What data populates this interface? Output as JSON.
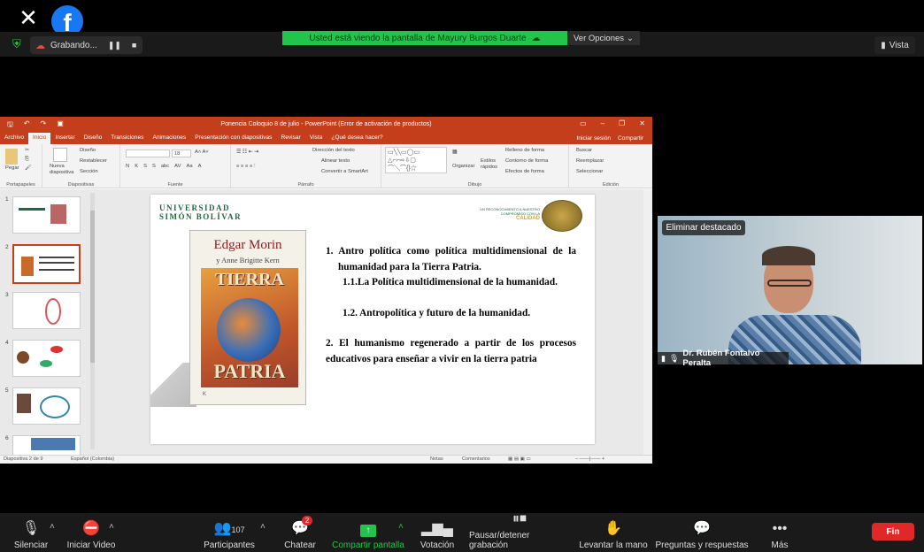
{
  "top": {
    "close_icon": "✕",
    "facebook_letter": "f",
    "recording_label": "Grabando...",
    "viewing_text": "Usted está viendo la pantalla de Mayury Burgos Duarte",
    "options_label": "Ver Opciones",
    "view_label": "Vista"
  },
  "ppt": {
    "title": "Ponencia Coloquio 8 de julio - PowerPoint (Error de activación de productos)",
    "tabs": [
      "Archivo",
      "Inicio",
      "Insertar",
      "Diseño",
      "Transiciones",
      "Animaciones",
      "Presentación con diapositivas",
      "Revisar",
      "Vista",
      "¿Qué desea hacer?"
    ],
    "active_tab": "Inicio",
    "signin": "Iniciar sesión",
    "share": "Compartir",
    "ribbon": {
      "paste": "Pegar",
      "new_slide": "Nueva diapositiva",
      "layout": "Diseño",
      "reset": "Restablecer",
      "section": "Sección",
      "font_size": "18",
      "groups": [
        "Portapapeles",
        "Diapositivas",
        "Fuente",
        "Párrafo",
        "Dibujo",
        "Edición"
      ],
      "text_direction": "Dirección del texto",
      "align_text": "Alinear texto",
      "smartart": "Convertir a SmartArt",
      "organize": "Organizar",
      "quick_styles": "Estilos rápidos",
      "shape_fill": "Relleno de forma",
      "shape_outline": "Contorno de forma",
      "shape_effects": "Efectos de forma",
      "find": "Buscar",
      "replace": "Reemplazar",
      "select": "Seleccionar",
      "font_buttons": [
        "N",
        "K",
        "S",
        "S",
        "abc",
        "AV",
        "Aa",
        "A"
      ]
    },
    "status": {
      "slide": "Diapositiva 2 de 9",
      "language": "Español (Colombia)",
      "notes": "Notas",
      "comments": "Comentarios"
    },
    "thumbnails": [
      "1",
      "2",
      "3",
      "4",
      "5",
      "6"
    ],
    "selected_thumb": "2"
  },
  "slide": {
    "university": "UNIVERSIDAD",
    "university2": "SIMÓN BOLÍVAR",
    "accred_small": "UN RECONOCIMIENTO A NUESTRO COMPROMISO CON LA",
    "accred_big": "CALIDAD",
    "book_author": "Edgar Morin",
    "book_coauthor": "y Anne Brigitte Kern",
    "book_title1": "TIERRA",
    "book_title2": "PATRIA",
    "item1": "1.  Antro política como política multidimensional de la humanidad para la Tierra Patria.",
    "item1_1": "1.1.La   Política   multidimensional   de   la humanidad.",
    "item1_2": "1.2. Antropolítica y futuro de la humanidad.",
    "item2": "2.   El humanismo regenerado a partir de los procesos educativos para enseñar a vivir en la tierra patria"
  },
  "video": {
    "remove_spotlight": "Eliminar destacado",
    "participant_name": "Dr. Rubén Fontalvo Peralta"
  },
  "bottom": {
    "mute": "Silenciar",
    "start_video": "Iniciar Video",
    "participants": "Participantes",
    "participants_count": "107",
    "chat": "Chatear",
    "chat_badge": "2",
    "share": "Compartir pantalla",
    "poll": "Votación",
    "pause_rec": "Pausar/detener grabación",
    "raise_hand": "Levantar la mano",
    "qa": "Preguntas y respuestas",
    "more": "Más",
    "end": "Fin"
  },
  "colors": {
    "ppt_accent": "#c43e1c",
    "zoom_green": "#23c44c",
    "end_red": "#e02828"
  }
}
